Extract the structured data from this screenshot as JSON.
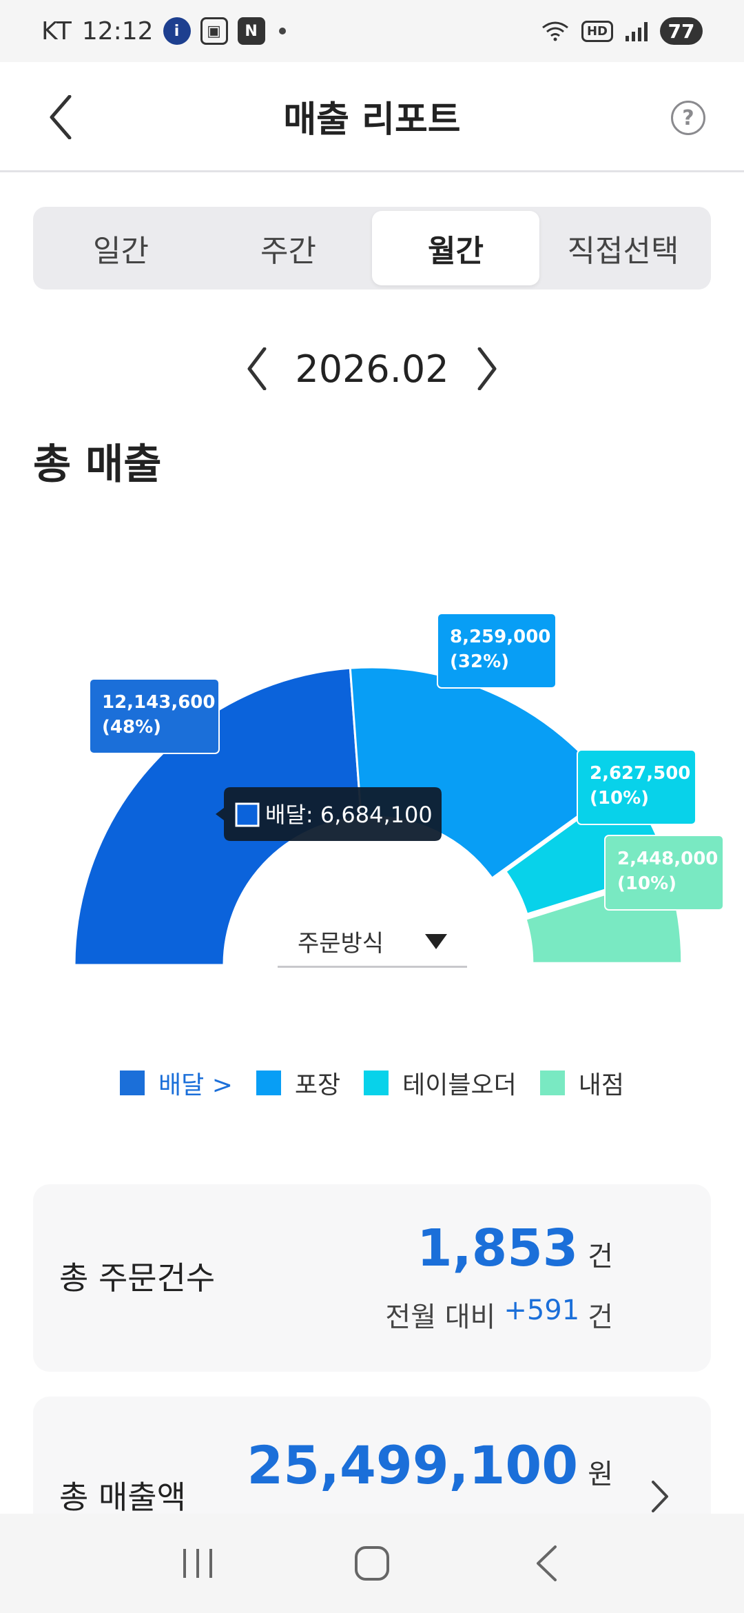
{
  "status_bar": {
    "carrier": "KT",
    "time": "12:12",
    "hd": "HD",
    "battery": "77",
    "app_badge": "i",
    "n_badge": "N"
  },
  "header": {
    "title": "매출 리포트",
    "help": "?"
  },
  "tabs": [
    {
      "label": "일간",
      "active": false
    },
    {
      "label": "주간",
      "active": false
    },
    {
      "label": "월간",
      "active": true
    },
    {
      "label": "직접선택",
      "active": false
    }
  ],
  "period": {
    "label": "2026.02"
  },
  "section_title": "총 매출",
  "chart_data": {
    "type": "pie",
    "variant": "half-donut",
    "categories": [
      "배달",
      "포장",
      "테이블오더",
      "내점"
    ],
    "values": [
      12143600,
      8259000,
      2627500,
      2448000
    ],
    "labels": [
      "12,143,600\n(48%)",
      "8,259,000\n(32%)",
      "2,627,500\n(10%)",
      "2,448,000\n(10%)"
    ],
    "colors": [
      "#0b63db",
      "#089ef5",
      "#08d2ea",
      "#79e9c2"
    ],
    "tooltip": {
      "category": "배달",
      "text": "배달: 6,684,100"
    },
    "legend_position": "bottom"
  },
  "order_method": {
    "label": "주문방식"
  },
  "legend": [
    {
      "label": "배달 >",
      "color": "#1b6fd9",
      "selected": true
    },
    {
      "label": "포장",
      "color": "#089ef5",
      "selected": false
    },
    {
      "label": "테이블오더",
      "color": "#08d2ea",
      "selected": false
    },
    {
      "label": "내점",
      "color": "#79e9c2",
      "selected": false
    }
  ],
  "orders_card": {
    "label": "총 주문건수",
    "value": "1,853",
    "unit": "건",
    "compare_prefix": "전월 대비",
    "compare_delta": "+591",
    "compare_unit": "건"
  },
  "sales_card": {
    "label": "총 매출액",
    "value": "25,499,100",
    "unit": "원"
  }
}
